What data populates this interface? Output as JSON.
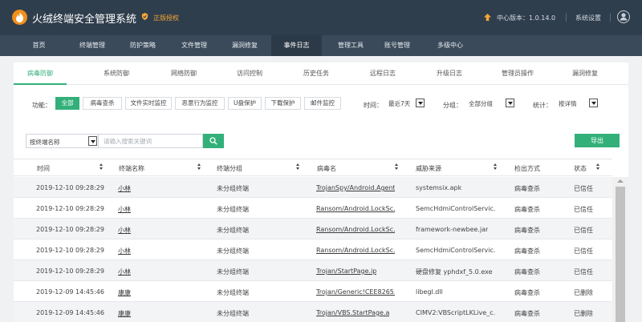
{
  "header": {
    "app_title": "火绒终端安全管理系统",
    "license": "正版授权",
    "version": "中心版本：1.0.14.0",
    "settings": "系统设置"
  },
  "nav": [
    "首页",
    "终端管理",
    "防护策略",
    "文件管理",
    "漏洞修复",
    "事件日志",
    "管理工具",
    "账号管理",
    "多级中心"
  ],
  "nav_active": "事件日志",
  "tabs": [
    "病毒防御",
    "系统防御",
    "网络防御",
    "访问控制",
    "历史任务",
    "远程日志",
    "升级日志",
    "管理员操作",
    "漏洞修复"
  ],
  "tab_active": "病毒防御",
  "filters": {
    "function_label": "功能：",
    "functions": [
      "全部",
      "病毒查杀",
      "文件实时监控",
      "恶意行为监控",
      "U盘保护",
      "下载保护",
      "邮件监控"
    ],
    "function_active": "全部",
    "time_label": "时间：",
    "time_value": "最近7天",
    "group_label": "分组：",
    "group_value": "全部分组",
    "stats_label": "统计：",
    "stats_value": "按详情"
  },
  "search": {
    "select_value": "按终端名称",
    "placeholder": "请输入搜索关键词",
    "export_label": "导出"
  },
  "table": {
    "headers": [
      "时间",
      "终端名称",
      "终端分组",
      "病毒名",
      "威胁来源",
      "检出方式",
      "状态"
    ],
    "rows": [
      [
        "2019-12-10 09:28:29",
        "小林",
        "未分组终端",
        "TrojanSpy/Android.Agent",
        "systemsix.apk",
        "病毒查杀",
        "已信任"
      ],
      [
        "2019-12-10 09:28:29",
        "小林",
        "未分组终端",
        "Ransom/Android.LockSc...",
        "SemcHdmiControlServic...",
        "病毒查杀",
        "已信任"
      ],
      [
        "2019-12-10 09:28:29",
        "小林",
        "未分组终端",
        "Ransom/Android.LockSc...",
        "framework-newbee.jar",
        "病毒查杀",
        "已信任"
      ],
      [
        "2019-12-10 09:28:29",
        "小林",
        "未分组终端",
        "Ransom/Android.LockSc...",
        "SemcHdmiControlServic...",
        "病毒查杀",
        "已信任"
      ],
      [
        "2019-12-10 09:28:29",
        "小林",
        "未分组终端",
        "Trojan/StartPage.ip",
        "硬盘修复 yphdxf_5.0.exe",
        "病毒查杀",
        "已信任"
      ],
      [
        "2019-12-09 14:45:46",
        "康康",
        "未分组终端",
        "Trojan/Generic!CEE8265...",
        "libegl.dll",
        "病毒查杀",
        "已删除"
      ],
      [
        "2019-12-09 14:45:46",
        "康康",
        "未分组终端",
        "Trojan/VBS.StartPage.a",
        "CIMV2:VBScriptLKLive_c...",
        "病毒查杀",
        "已删除"
      ]
    ]
  },
  "colors": {
    "accent": "#33b07a",
    "header_bg": "#2f3e4d",
    "nav_bg": "#3a4a5b",
    "license": "#f7a733"
  }
}
